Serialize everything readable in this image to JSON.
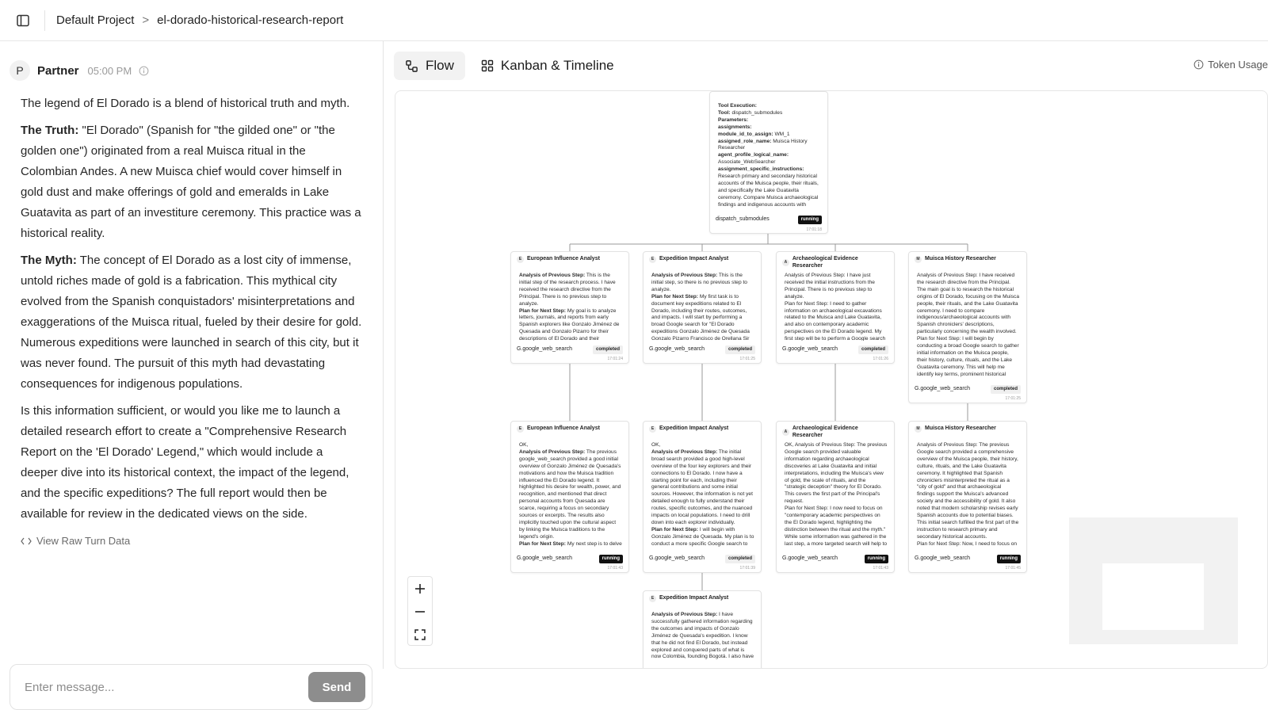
{
  "breadcrumb": {
    "project": "Default Project",
    "separator": ">",
    "page": "el-dorado-historical-research-report"
  },
  "chat": {
    "avatar": "P",
    "sender": "Partner",
    "time": "05:00 PM",
    "intro": "The legend of El Dorado is a blend of historical truth and myth.",
    "truth_label": "The Truth:",
    "truth_text": " \"El Dorado\" (Spanish for \"the gilded one\" or \"the golden one\") originated from a real Muisca ritual in the Colombian Andes. A new Muisca chief would cover himself in gold dust and make offerings of gold and emeralds in Lake Guatavita as part of an investiture ceremony. This practice was a historical reality.",
    "myth_label": "The Myth:",
    "myth_text": " The concept of El Dorado as a lost city of immense, untold riches made of gold is a fabrication. This mythical city evolved from the Spanish conquistadors' misinterpretations and exaggerations of the Muisca ritual, fueled by their desire for gold. Numerous expeditions were launched in search of this city, but it was never found. The pursuit of this myth had devastating consequences for indigenous populations.",
    "question": "Is this information sufficient, or would you like me to launch a detailed research effort to create a \"Comprehensive Research Report on the 'El Dorado' Legend,\" which would include a deeper dive into its historical context, the impact of the legend, and the specific expeditions? The full report would then be available for review in the dedicated views on the side.",
    "raw_link": "View Raw Turn Data",
    "input_placeholder": "Enter message...",
    "send_label": "Send"
  },
  "tabs": [
    {
      "label": "Flow"
    },
    {
      "label": "Kanban & Timeline"
    }
  ],
  "token_usage": "Token Usage",
  "root_node": {
    "lines": [
      {
        "b": "Tool Execution:",
        "t": ""
      },
      {
        "b": "Tool:",
        "t": " dispatch_submodules"
      },
      {
        "b": "Parameters:",
        "t": ""
      },
      {
        "b": "assignments:",
        "t": ""
      },
      {
        "b": "module_id_to_assign:",
        "t": " WM_1"
      },
      {
        "b": "assigned_role_name:",
        "t": " Muisca History Researcher"
      },
      {
        "b": "agent_profile_logical_name:",
        "t": ""
      },
      {
        "b": "",
        "t": "Associate_WebSearcher"
      },
      {
        "b": "assignment_specific_instructions:",
        "t": ""
      },
      {
        "b": "",
        "t": "Research primary and secondary historical accounts of the Muisca people, their rituals, and specifically the Lake Guatavita ceremony. Compare Muisca archaeological findings and indigenous accounts with"
      }
    ],
    "tool": "dispatch_submodules",
    "status": "running",
    "time": "17:01:18"
  },
  "row1": [
    {
      "badge": "E",
      "title": "European Influence Analyst",
      "lines": [
        {
          "b": "Analysis of Previous Step:",
          "t": " This is the initial step of the research process. I have received the research directive from the Principal. There is no previous step to analyze."
        },
        {
          "b": "Plan for Next Step:",
          "t": " My goal is to analyze letters, journals, and reports from early Spanish explorers like Gonzalo Jiménez de Quesada and Gonzalo Pizarro for their descriptions of El Dorado and their"
        }
      ],
      "tool": "G.google_web_search",
      "status": "completed",
      "time": "17:01:24"
    },
    {
      "badge": "E",
      "title": "Expedition Impact Analyst",
      "lines": [
        {
          "b": "Analysis of Previous Step:",
          "t": " This is the initial step, so there is no previous step to analyze."
        },
        {
          "b": "Plan for Next Step:",
          "t": " My first task is to document key expeditions related to El Dorado, including their routes, outcomes, and impacts. I will start by performing a broad Google search for \"El Dorado expeditions Gonzalo Jiménez de Quesada Gonzalo Pizarro Francisco de Orellana Sir Walter Raleigh\" to gather initial information"
        }
      ],
      "tool": "G.google_web_search",
      "status": "completed",
      "time": "17:01:25"
    },
    {
      "badge": "A",
      "title": "Archaeological Evidence Researcher",
      "lines": [
        {
          "b": "",
          "t": "Analysis of Previous Step: I have just received the initial instructions from the Principal. There is no previous step to analyze."
        },
        {
          "b": "",
          "t": "Plan for Next Step: I need to gather information on archaeological excavations related to the Muisca and Lake Guatavita, and also on contemporary academic perspectives on the El Dorado legend. My first step will be to perform a Google search"
        }
      ],
      "tool": "G.google_web_search",
      "status": "completed",
      "time": "17:01:26"
    },
    {
      "badge": "M",
      "title": "Muisca History Researcher",
      "lines": [
        {
          "b": "",
          "t": "Analysis of Previous Step: I have received the research directive from the Principal. The main goal is to research the historical origins of El Dorado, focusing on the Muisca people, their rituals, and the Lake Guatavita ceremony. I need to compare indigenous/archaeological accounts with Spanish chroniclers' descriptions, particularly concerning the wealth involved."
        },
        {
          "b": "",
          "t": "Plan for Next Step: I will begin by conducting a broad Google search to gather initial information on the Muisca people, their history, culture, rituals, and the Lake Guatavita ceremony. This will help me identify key terms, prominent historical figures, and"
        }
      ],
      "tool": "G.google_web_search",
      "status": "completed",
      "time": "17:01:25"
    }
  ],
  "row2": [
    {
      "badge": "E",
      "title": "European Influence Analyst",
      "lines": [
        {
          "b": "",
          "t": "OK,"
        },
        {
          "b": "Analysis of Previous Step:",
          "t": " The previous google_web_search provided a good initial overview of Gonzalo Jiménez de Quesada's motivations and how the Muisca tradition influenced the El Dorado legend. It highlighted his desire for wealth, power, and recognition, and mentioned that direct personal accounts from Quesada are scarce, requiring a focus on secondary sources or excerpts. The results also implicitly touched upon the cultural aspect by linking the Muisca traditions to the legend's origin."
        },
        {
          "b": "Plan for Next Step:",
          "t": " My next step is to delve"
        }
      ],
      "tool": "G.google_web_search",
      "status": "running",
      "time": "17:01:43"
    },
    {
      "badge": "E",
      "title": "Expedition Impact Analyst",
      "lines": [
        {
          "b": "",
          "t": "OK,"
        },
        {
          "b": "Analysis of Previous Step:",
          "t": " The initial broad search provided a good high-level overview of the four key explorers and their connections to El Dorado. I now have a starting point for each, including their general contributions and some initial sources. However, the information is not yet detailed enough to fully understand their routes, specific outcomes, and the nuanced impacts on local populations. I need to drill down into each explorer individually."
        },
        {
          "b": "Plan for Next Step:",
          "t": " I will begin with Gonzalo Jiménez de Quesada. My plan is to conduct a more specific Google search to"
        }
      ],
      "tool": "G.google_web_search",
      "status": "completed",
      "time": "17:01:39"
    },
    {
      "badge": "A",
      "title": "Archaeological Evidence Researcher",
      "lines": [
        {
          "b": "",
          "t": "OK, Analysis of Previous Step: The previous Google search provided valuable information regarding archaeological discoveries at Lake Guatavita and initial interpretations, including the Muisca's view of gold, the scale of rituals, and the \"strategic deception\" theory for El Dorado. This covers the first part of the Principal's request."
        },
        {
          "b": "",
          "t": "Plan for Next Step: I now need to focus on \"contemporary academic perspectives on the El Dorado legend, highlighting the distinction between the ritual and the myth.\" While some information was gathered in the last step, a more targeted search will help to"
        }
      ],
      "tool": "G.google_web_search",
      "status": "running",
      "time": "17:01:43"
    },
    {
      "badge": "M",
      "title": "Muisca History Researcher",
      "lines": [
        {
          "b": "",
          "t": "Analysis of Previous Step: The previous Google search provided a comprehensive overview of the Muisca people, their history, culture, rituals, and the Lake Guatavita ceremony. It highlighted that Spanish chroniclers misinterpreted the ritual as a \"city of gold\" and that archaeological findings support the Muisca's advanced society and the accessibility of gold. It also noted that modern scholarship revises early Spanish accounts due to potential biases. This initial search fulfilled the first part of the instruction to research primary and secondary historical accounts."
        },
        {
          "b": "",
          "t": "Plan for Next Step: Now, I need to focus on"
        }
      ],
      "tool": "G.google_web_search",
      "status": "running",
      "time": "17:01:45"
    }
  ],
  "row3": {
    "badge": "E",
    "title": "Expedition Impact Analyst",
    "lines": [
      {
        "b": "Analysis of Previous Step:",
        "t": " I have successfully gathered information regarding the outcomes and impacts of Gonzalo Jiménez de Quesada's expedition. I know that he did not find El Dorado, but instead explored and conquered parts of what is now Colombia, founding Bogotá. I also have"
      }
    ]
  },
  "colors": {
    "running": "#111111",
    "send": "#8d8d8d",
    "accent_tab_bg": "#f2f2f2"
  }
}
